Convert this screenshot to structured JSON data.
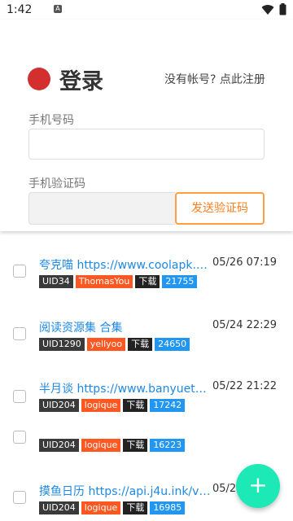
{
  "status": {
    "time": "1:42",
    "notif_icon": "A"
  },
  "login": {
    "title": "登录",
    "register_text": "没有帐号?",
    "register_link": "点此注册",
    "phone_label": "手机号码",
    "phone_value": "",
    "code_label": "手机验证码",
    "code_value": "",
    "send_code_label": "发送验证码"
  },
  "list": [
    {
      "title": "夸克喵 https://www.coolapk.com/...",
      "date": "05/26 07:19",
      "uid": "UID34",
      "user": "ThomasYou",
      "dl_label": "下载",
      "dl_count": "21755"
    },
    {
      "title": "阅读资源集 合集",
      "date": "05/24 22:29",
      "uid": "UID1290",
      "user": "yellyoo",
      "dl_label": "下载",
      "dl_count": "24650"
    },
    {
      "title": "半月谈 https://www.banyuetanap...",
      "date": "05/22 21:22",
      "uid": "UID204",
      "user": "logique",
      "dl_label": "下载",
      "dl_count": "17242"
    },
    {
      "title": "",
      "date": "",
      "uid": "UID204",
      "user": "logique",
      "dl_label": "下载",
      "dl_count": "16223"
    },
    {
      "title": "摸鱼日历 https://api.j4u.ink/v1/st...",
      "date": "05/2",
      "uid": "UID204",
      "user": "logique",
      "dl_label": "下载",
      "dl_count": "16985"
    }
  ],
  "fab_label": "+",
  "colors": {
    "accent_orange": "#ff7f1f",
    "link_blue": "#1e88e5",
    "fab": "#1de9b6",
    "brand_red": "#d32f2f"
  }
}
